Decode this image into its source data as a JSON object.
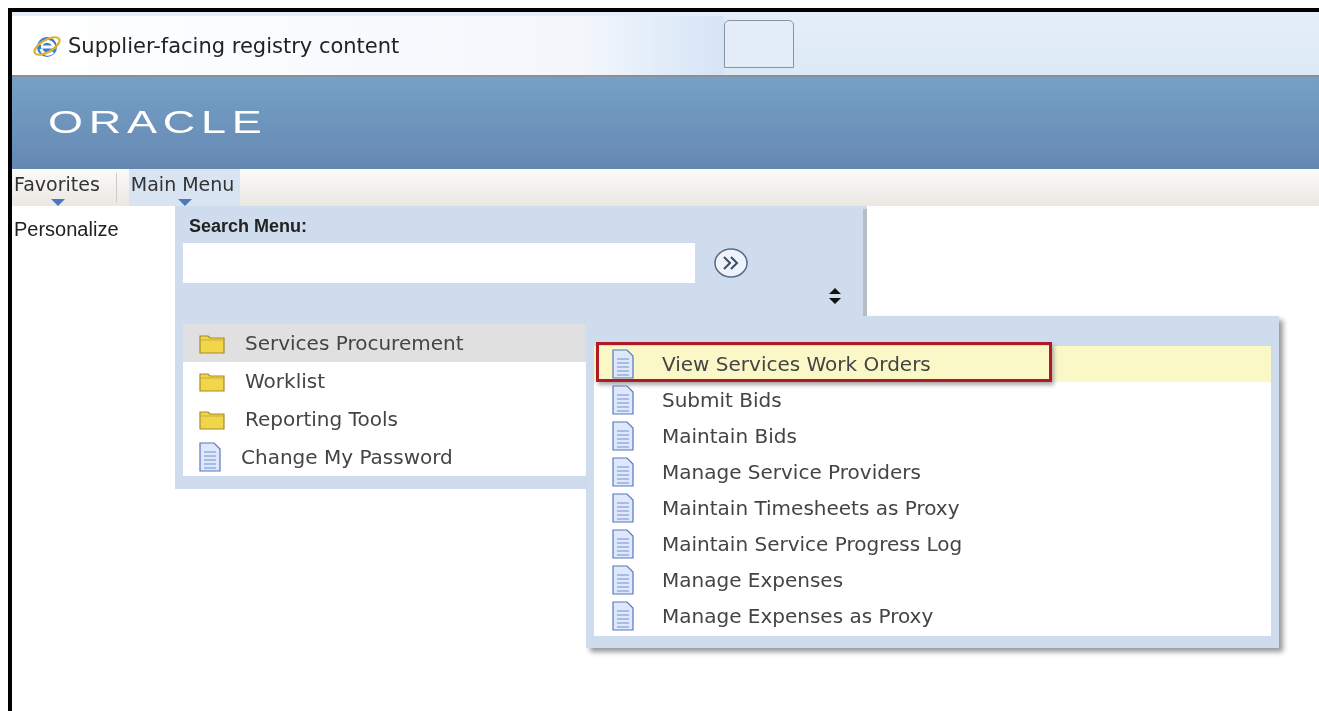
{
  "window": {
    "title": "Supplier-facing registry content"
  },
  "header": {
    "logo": "ORACLE"
  },
  "menubar": [
    {
      "label": "Favorites",
      "selected": false
    },
    {
      "label": "Main Menu",
      "selected": true
    }
  ],
  "page": {
    "link": "Personalize"
  },
  "search": {
    "label": "Search Menu:"
  },
  "menu": {
    "items": [
      {
        "label": "Services Procurement",
        "kind": "folder",
        "selected": true
      },
      {
        "label": "Worklist",
        "kind": "folder",
        "selected": false
      },
      {
        "label": "Reporting Tools",
        "kind": "folder",
        "selected": false
      },
      {
        "label": "Change My Password",
        "kind": "page",
        "selected": false
      }
    ]
  },
  "submenu": {
    "items": [
      {
        "label": "View Services Work Orders",
        "kind": "page",
        "selected": true,
        "annotated": true
      },
      {
        "label": "Submit Bids",
        "kind": "page",
        "selected": false,
        "annotated": false
      },
      {
        "label": "Maintain Bids",
        "kind": "page",
        "selected": false,
        "annotated": false
      },
      {
        "label": "Manage Service Providers",
        "kind": "page",
        "selected": false,
        "annotated": false
      },
      {
        "label": "Maintain Timesheets as Proxy",
        "kind": "page",
        "selected": false,
        "annotated": false
      },
      {
        "label": "Maintain Service Progress Log",
        "kind": "page",
        "selected": false,
        "annotated": false
      },
      {
        "label": "Manage Expenses",
        "kind": "page",
        "selected": false,
        "annotated": false
      },
      {
        "label": "Manage Expenses as Proxy",
        "kind": "page",
        "selected": false,
        "annotated": false
      }
    ]
  }
}
